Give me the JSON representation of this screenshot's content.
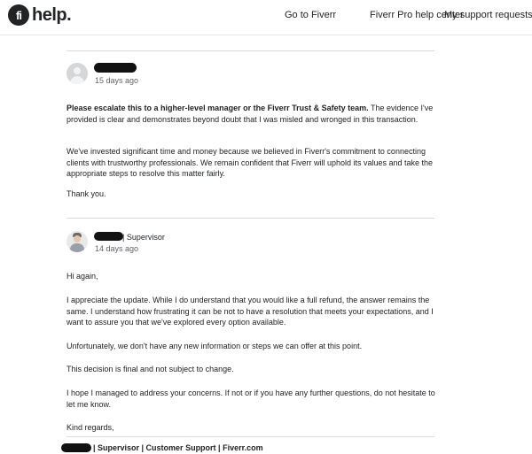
{
  "header": {
    "logo_mark": "fi",
    "logo_text": "help.",
    "nav": {
      "go_to_fiverr": "Go to Fiverr",
      "pro_help_center": "Fiverr Pro help center",
      "my_support_requests": "My support requests"
    }
  },
  "comments": [
    {
      "author_redacted": true,
      "time": "15 days ago",
      "paragraphs": {
        "p1_bold": "Please escalate this to a higher-level manager or the Fiverr Trust & Safety team.",
        "p1_rest": " The evidence I've provided is clear and demonstrates beyond doubt that I was misled and wronged in this transaction.",
        "p2": "We've invested significant time and money because we believed in Fiverr's commitment to connecting clients with trustworthy professionals. We remain confident that Fiverr will uphold its values and take the appropriate steps to resolve this matter fairly.",
        "p3": "Thank you."
      }
    },
    {
      "author_redacted": true,
      "role": "| Supervisor",
      "time": "14 days ago",
      "paragraphs": {
        "p1": "Hi again,",
        "p2": "I appreciate the update. While I do understand that you would like a full refund, the answer remains the same. I understand how frustrating it can be not to have a resolution that meets your expectations, and I want to assure you that we've explored every option available.",
        "p3": "Unfortunately, we don't have any new information or steps we can offer at this point.",
        "p4": "This decision is final and not subject to change.",
        "p5": "I hope I managed to address your concerns. If not or if you have any further questions, do not hesitate to let me know.",
        "p6": "Kind regards,"
      },
      "signature": "| Supervisor | Customer Support | Fiverr.com"
    }
  ]
}
